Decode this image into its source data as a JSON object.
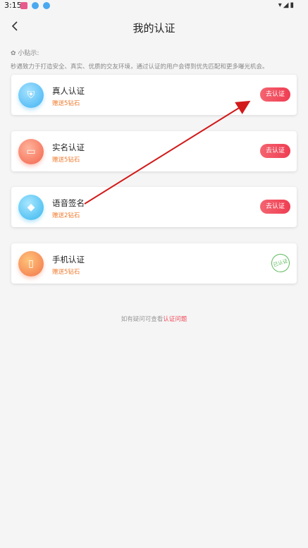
{
  "status_bar": {
    "time": "3:15",
    "right_icons": "▾◢▮"
  },
  "header": {
    "title": "我的认证",
    "back_icon": "chevron-left-icon"
  },
  "tip": {
    "label": "✿ 小贴示:",
    "text": "秒遇致力于打造安全、真实、优质的交友环境，通过认证的用户会得到优先匹配和更多曝光机会。"
  },
  "cards": [
    {
      "title": "真人认证",
      "reward": "赠送5钻石",
      "action": "去认证",
      "icon": "shield-icon",
      "glyph": "⛨"
    },
    {
      "title": "实名认证",
      "reward": "赠送5钻石",
      "action": "去认证",
      "icon": "id-card-icon",
      "glyph": "▭"
    },
    {
      "title": "语音签名",
      "reward": "赠送2钻石",
      "action": "去认证",
      "icon": "diamond-icon",
      "glyph": "◆"
    },
    {
      "title": "手机认证",
      "reward": "赠送5钻石",
      "action": "已认证",
      "icon": "phone-icon",
      "glyph": "▯"
    }
  ],
  "footer": {
    "prefix": "如有疑问可查看",
    "link": "认证问题"
  },
  "colors": {
    "accent": "#ef4b5a",
    "reward": "#f07a2e",
    "verified": "#5cb85c",
    "annotation": "#d21a1a"
  }
}
